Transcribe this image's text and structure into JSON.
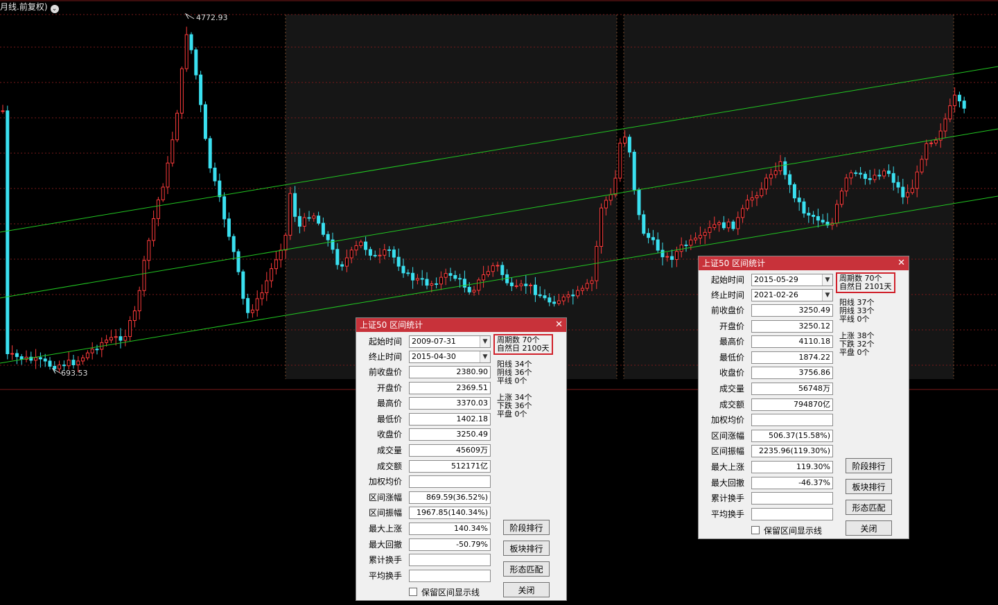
{
  "header": {
    "title": "月线.前复权)",
    "dropdown_icon": "chevron-down-icon"
  },
  "chart_labels": {
    "high": "4772.93",
    "low": "693.53"
  },
  "colors": {
    "up": "#ff3b3b",
    "down": "#3ae0f0",
    "channel": "#22c822",
    "grid": "#7a1a1a",
    "title_bar": "#c8323a",
    "highlight": "#d0202a"
  },
  "panels": [
    {
      "title": "上证50 区间统计",
      "close": "✕",
      "start_label": "起始时间",
      "start_value": "2009-07-31",
      "end_label": "终止时间",
      "end_value": "2015-04-30",
      "period": "周期数  70个",
      "natural_days": "自然日  2100天",
      "yang": "阳线  34个",
      "yin": "阴线  36个",
      "ping": "平线  0个",
      "up": "上涨  34个",
      "down": "下跌  36个",
      "flat": "平盘  0个",
      "rows": [
        {
          "label": "前收盘价",
          "value": "2380.90"
        },
        {
          "label": "开盘价",
          "value": "2369.51"
        },
        {
          "label": "最高价",
          "value": "3370.03"
        },
        {
          "label": "最低价",
          "value": "1402.18"
        },
        {
          "label": "收盘价",
          "value": "3250.49"
        },
        {
          "label": "成交量",
          "value": "45609万"
        },
        {
          "label": "成交额",
          "value": "512171亿"
        },
        {
          "label": "加权均价",
          "value": ""
        },
        {
          "label": "区间涨幅",
          "value": "869.59(36.52%)"
        },
        {
          "label": "区间振幅",
          "value": "1967.85(140.34%)"
        },
        {
          "label": "最大上涨",
          "value": "140.34%"
        },
        {
          "label": "最大回撤",
          "value": "-50.79%"
        },
        {
          "label": "累计换手",
          "value": ""
        },
        {
          "label": "平均换手",
          "value": ""
        }
      ],
      "buttons": [
        "阶段排行",
        "板块排行",
        "形态匹配",
        "关闭"
      ],
      "keep_lines": "保留区间显示线"
    },
    {
      "title": "上证50 区间统计",
      "close": "✕",
      "start_label": "起始时间",
      "start_value": "2015-05-29",
      "end_label": "终止时间",
      "end_value": "2021-02-26",
      "period": "周期数  70个",
      "natural_days": "自然日  2101天",
      "yang": "阳线  37个",
      "yin": "阴线  33个",
      "ping": "平线  0个",
      "up": "上涨  38个",
      "down": "下跌  32个",
      "flat": "平盘  0个",
      "rows": [
        {
          "label": "前收盘价",
          "value": "3250.49"
        },
        {
          "label": "开盘价",
          "value": "3250.12"
        },
        {
          "label": "最高价",
          "value": "4110.18"
        },
        {
          "label": "最低价",
          "value": "1874.22"
        },
        {
          "label": "收盘价",
          "value": "3756.86"
        },
        {
          "label": "成交量",
          "value": "56748万"
        },
        {
          "label": "成交额",
          "value": "794870亿"
        },
        {
          "label": "加权均价",
          "value": ""
        },
        {
          "label": "区间涨幅",
          "value": "506.37(15.58%)"
        },
        {
          "label": "区间振幅",
          "value": "2235.96(119.30%)"
        },
        {
          "label": "最大上涨",
          "value": "119.30%"
        },
        {
          "label": "最大回撤",
          "value": "-46.37%"
        },
        {
          "label": "累计换手",
          "value": ""
        },
        {
          "label": "平均换手",
          "value": ""
        }
      ],
      "buttons": [
        "阶段排行",
        "板块排行",
        "形态匹配",
        "关闭"
      ],
      "keep_lines": "保留区间显示线"
    }
  ]
}
